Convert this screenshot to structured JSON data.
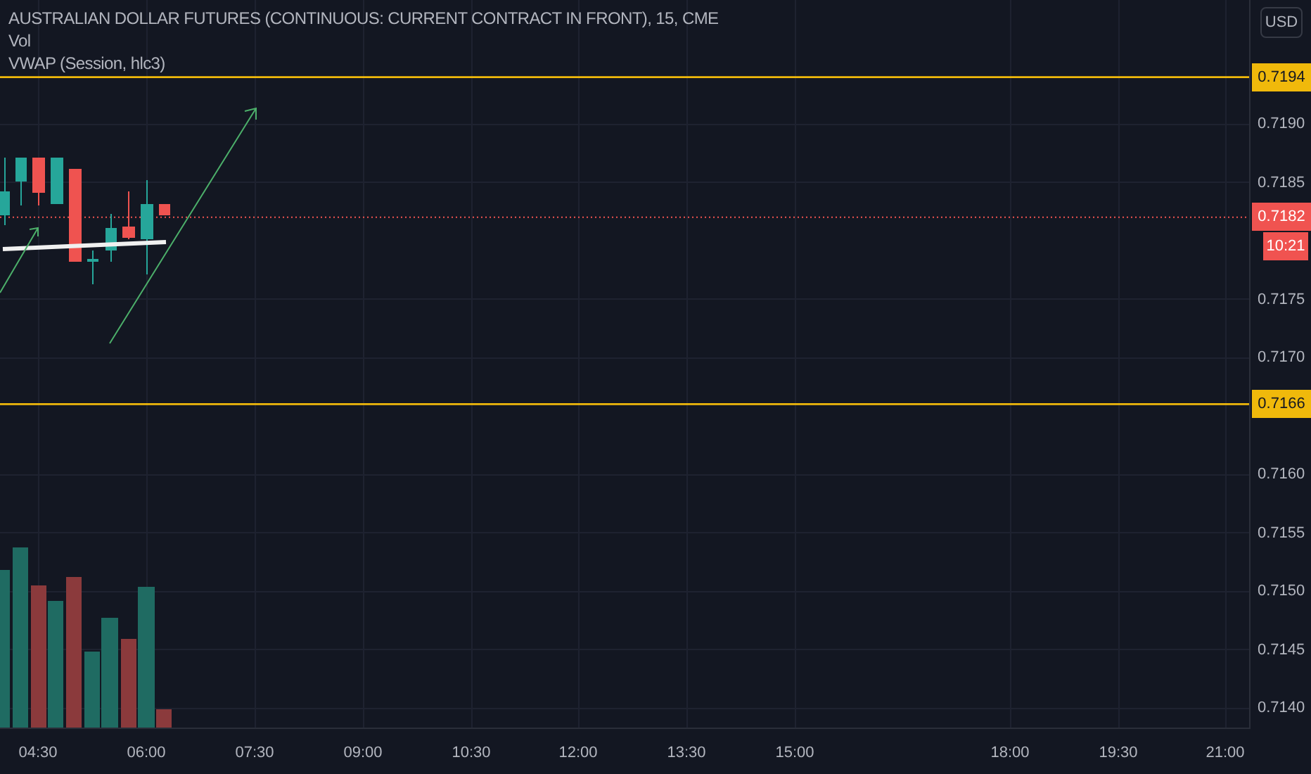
{
  "legend": {
    "title": "AUSTRALIAN DOLLAR FUTURES (CONTINUOUS: CURRENT CONTRACT IN FRONT), 15, CME",
    "indicators": [
      "Vol",
      "VWAP (Session, hlc3)"
    ]
  },
  "currency_button": "USD",
  "price_axis": [
    "0.7190",
    "0.7185",
    "0.7175",
    "0.7170",
    "0.7160",
    "0.7155",
    "0.7150",
    "0.7145",
    "0.7140"
  ],
  "price_badges": [
    {
      "kind": "level",
      "text": "0.7194",
      "color": "#f0b90b"
    },
    {
      "kind": "last",
      "text": "0.7182",
      "color": "#f05350"
    },
    {
      "kind": "countdown",
      "text": "10:21",
      "color": "#f05350"
    },
    {
      "kind": "level",
      "text": "0.7166",
      "color": "#f0b90b"
    }
  ],
  "time_axis": [
    "04:30",
    "06:00",
    "07:30",
    "09:00",
    "10:30",
    "12:00",
    "13:30",
    "15:00",
    "18:00",
    "19:30",
    "21:00"
  ]
}
